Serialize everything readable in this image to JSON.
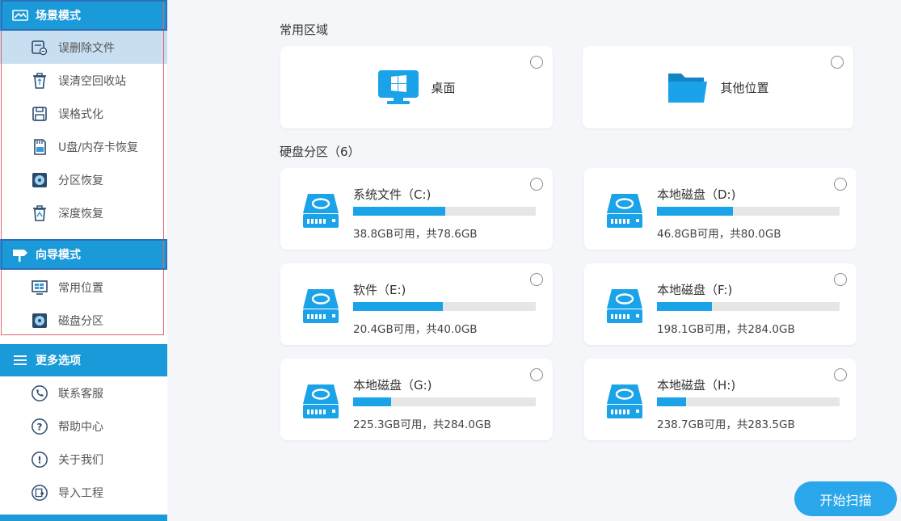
{
  "colors": {
    "accent": "#1a9ad9",
    "active_item": "#c7dff0",
    "bar_fill": "#1aa3e8",
    "bar_track": "#e6e6e6"
  },
  "sidebar": {
    "scene_mode": {
      "title": "场景模式",
      "icon": "scene-mode-icon",
      "items": [
        {
          "label": "误删除文件",
          "icon": "deleted-file-icon",
          "active": true
        },
        {
          "label": "误清空回收站",
          "icon": "recycle-bin-icon",
          "active": false
        },
        {
          "label": "误格式化",
          "icon": "format-disk-icon",
          "active": false
        },
        {
          "label": "U盘/内存卡恢复",
          "icon": "sd-card-icon",
          "active": false
        },
        {
          "label": "分区恢复",
          "icon": "partition-icon",
          "active": false
        },
        {
          "label": "深度恢复",
          "icon": "deep-recovery-icon",
          "active": false
        }
      ]
    },
    "guide_mode": {
      "title": "向导模式",
      "icon": "signpost-icon",
      "items": [
        {
          "label": "常用位置",
          "icon": "windows-location-icon"
        },
        {
          "label": "磁盘分区",
          "icon": "disk-partition-icon"
        }
      ]
    },
    "more_options": {
      "title": "更多选项",
      "icon": "menu-icon",
      "items": [
        {
          "label": "联系客服",
          "icon": "phone-icon"
        },
        {
          "label": "帮助中心",
          "icon": "help-icon"
        },
        {
          "label": "关于我们",
          "icon": "info-icon"
        },
        {
          "label": "导入工程",
          "icon": "import-project-icon"
        }
      ]
    }
  },
  "main": {
    "common_area": {
      "title": "常用区域",
      "locations": [
        {
          "label": "桌面",
          "icon": "desktop-icon"
        },
        {
          "label": "其他位置",
          "icon": "folder-icon"
        }
      ]
    },
    "partitions": {
      "title": "硬盘分区（6）",
      "drives": [
        {
          "name": "系统文件（C:)",
          "info": "38.8GB可用，共78.6GB",
          "used_fraction": 0.506
        },
        {
          "name": "本地磁盘（D:)",
          "info": "46.8GB可用，共80.0GB",
          "used_fraction": 0.415
        },
        {
          "name": "软件（E:)",
          "info": "20.4GB可用，共40.0GB",
          "used_fraction": 0.49
        },
        {
          "name": "本地磁盘（F:)",
          "info": "198.1GB可用，共284.0GB",
          "used_fraction": 0.302
        },
        {
          "name": "本地磁盘（G:)",
          "info": "225.3GB可用，共284.0GB",
          "used_fraction": 0.207
        },
        {
          "name": "本地磁盘（H:)",
          "info": "238.7GB可用，共283.5GB",
          "used_fraction": 0.158
        }
      ]
    },
    "scan_button": "开始扫描"
  }
}
